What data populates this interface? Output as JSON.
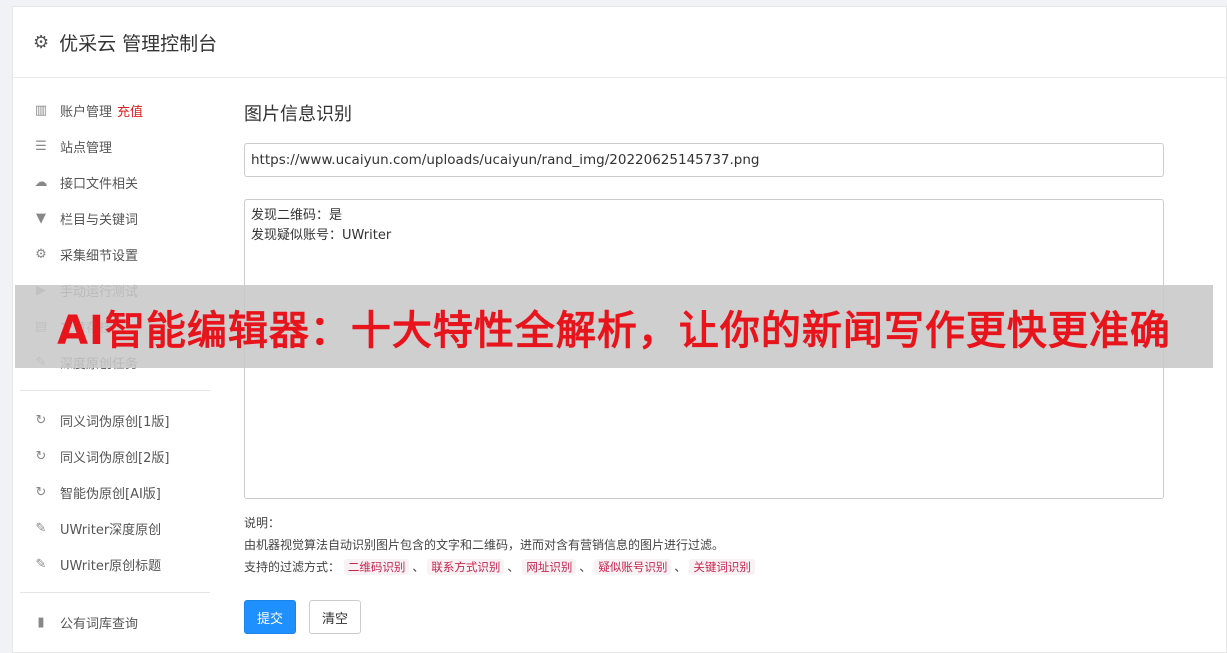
{
  "header": {
    "title": "优采云 管理控制台",
    "icon": "gear-icon"
  },
  "sidebar": {
    "groups": [
      [
        {
          "label": "账户管理",
          "extra": "充值",
          "icon": "bar-chart-icon"
        },
        {
          "label": "站点管理",
          "icon": "server-icon"
        },
        {
          "label": "接口文件相关",
          "icon": "cloud-upload-icon"
        },
        {
          "label": "栏目与关键词",
          "icon": "filter-icon"
        },
        {
          "label": "采集细节设置",
          "icon": "cogs-icon"
        },
        {
          "label": "手动运行测试",
          "icon": "play-icon"
        },
        {
          "label": "文章存档",
          "icon": "archive-icon"
        },
        {
          "label": "深度原创任务",
          "icon": "edit-icon"
        }
      ],
      [
        {
          "label": "同义词伪原创[1版]",
          "icon": "refresh-icon"
        },
        {
          "label": "同义词伪原创[2版]",
          "icon": "refresh-icon"
        },
        {
          "label": "智能伪原创[AI版]",
          "icon": "refresh-icon"
        },
        {
          "label": "UWriter深度原创",
          "icon": "edit-icon"
        },
        {
          "label": "UWriter原创标题",
          "icon": "edit-icon"
        }
      ],
      [
        {
          "label": "公有词库查询",
          "icon": "book-icon"
        }
      ]
    ]
  },
  "main": {
    "heading": "图片信息识别",
    "url_value": "https://www.ucaiyun.com/uploads/ucaiyun/rand_img/20220625145737.png",
    "result_lines": [
      "发现二维码：是",
      "发现疑似账号：UWriter"
    ],
    "desc_title": "说明：",
    "desc_text": "由机器视觉算法自动识别图片包含的文字和二维码，进而对含有营销信息的图片进行过滤。",
    "filter_label": "支持的过滤方式：",
    "filters": [
      "二维码识别",
      "联系方式识别",
      "网址识别",
      "疑似账号识别",
      "关键词识别"
    ],
    "separator": "、",
    "submit_label": "提交",
    "clear_label": "清空"
  },
  "banner": {
    "text": "AI智能编辑器：十大特性全解析，让你的新闻写作更快更准确"
  },
  "colors": {
    "primary": "#1e90ff",
    "danger": "#e02020",
    "banner_text": "#e8141c"
  }
}
